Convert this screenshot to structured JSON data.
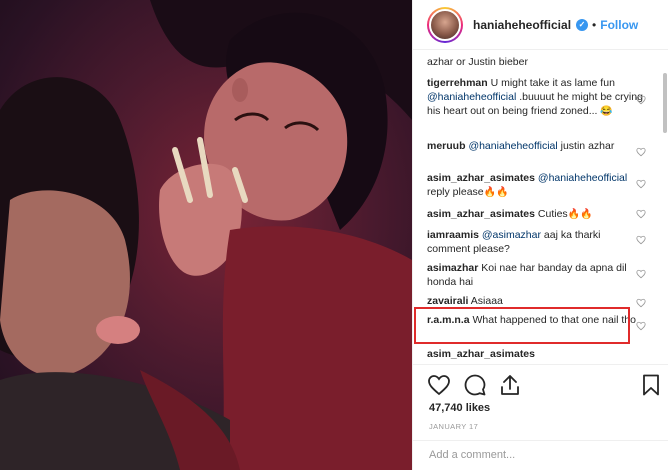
{
  "post": {
    "username": "haniaheheofficial",
    "verified": true,
    "follow_label": "Follow",
    "separator": "•"
  },
  "comments": [
    {
      "user": "",
      "parts": [
        {
          "t": "text",
          "v": "azhar or Justin bieber"
        }
      ],
      "heart": false
    },
    {
      "user": "tigerrehman",
      "parts": [
        {
          "t": "text",
          "v": " U might take it as lame fun "
        },
        {
          "t": "mention",
          "v": "@haniaheheofficial"
        },
        {
          "t": "text",
          "v": " .buuuut he might be crying his heart out on being friend zoned... "
        }
      ],
      "emoji": "😂",
      "heart": true
    },
    {
      "user": "meruub",
      "parts": [
        {
          "t": "text",
          "v": " "
        },
        {
          "t": "mention",
          "v": "@haniaheheofficial"
        },
        {
          "t": "text",
          "v": " justin azhar"
        }
      ],
      "heart": true
    },
    {
      "user": "asim_azhar_asimates",
      "parts": [
        {
          "t": "text",
          "v": " "
        },
        {
          "t": "mention",
          "v": "@haniaheheofficial"
        },
        {
          "t": "text",
          "v": " reply please"
        }
      ],
      "emoji": "🔥🔥",
      "heart": true
    },
    {
      "user": "asim_azhar_asimates",
      "parts": [
        {
          "t": "text",
          "v": " Cuties"
        }
      ],
      "emoji": "🔥🔥",
      "heart": true
    },
    {
      "user": "iamraamis",
      "parts": [
        {
          "t": "text",
          "v": " "
        },
        {
          "t": "mention",
          "v": "@asimazhar"
        },
        {
          "t": "text",
          "v": " aaj ka tharki comment please?"
        }
      ],
      "heart": true
    },
    {
      "user": "asimazhar",
      "parts": [
        {
          "t": "text",
          "v": " Koi nae har banday da apna dil honda hai"
        }
      ],
      "heart": true
    },
    {
      "user": "zavairali",
      "parts": [
        {
          "t": "text",
          "v": " Asiaaa"
        }
      ],
      "heart": true
    },
    {
      "user": "r.a.m.n.a",
      "parts": [
        {
          "t": "text",
          "v": " What happened to that one nail tho"
        }
      ],
      "heart": true
    },
    {
      "user": "asim_azhar_asimates",
      "parts": [
        {
          "t": "text",
          "v": ""
        }
      ],
      "heart": false
    }
  ],
  "likes_label": "47,740 likes",
  "date_label": "JANUARY 17",
  "add_comment": {
    "placeholder": "Add a comment..."
  },
  "colors": {
    "accent": "#3897f0",
    "highlight": "#e02b2b",
    "mention": "#003569"
  },
  "icons": {
    "verified": "verified-badge-icon",
    "heart": "heart-icon",
    "like": "heart-outline-icon",
    "comment": "comment-icon",
    "share": "share-icon",
    "save": "bookmark-icon"
  }
}
